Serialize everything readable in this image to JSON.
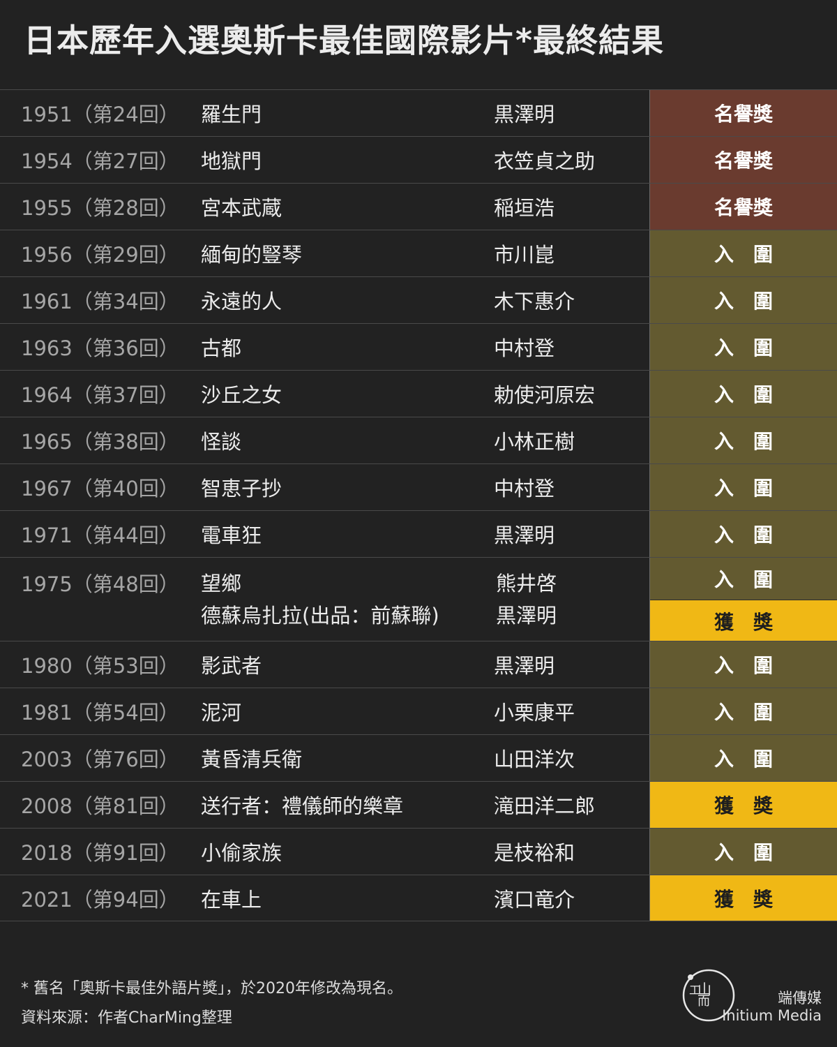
{
  "title": "日本歷年入選奧斯卡最佳國際影片*最終結果",
  "rows": [
    {
      "year": "1951（第24回）",
      "film": "羅生門",
      "director": "黒澤明",
      "result": "名譽獎",
      "type": "honor"
    },
    {
      "year": "1954（第27回）",
      "film": "地獄門",
      "director": "衣笠貞之助",
      "result": "名譽獎",
      "type": "honor"
    },
    {
      "year": "1955（第28回）",
      "film": "宮本武蔵",
      "director": "稲垣浩",
      "result": "名譽獎",
      "type": "honor"
    },
    {
      "year": "1956（第29回）",
      "film": "緬甸的豎琴",
      "director": "市川崑",
      "result": "入　圍",
      "type": "nom"
    },
    {
      "year": "1961（第34回）",
      "film": "永遠的人",
      "director": "木下惠介",
      "result": "入　圍",
      "type": "nom"
    },
    {
      "year": "1963（第36回）",
      "film": "古都",
      "director": "中村登",
      "result": "入　圍",
      "type": "nom"
    },
    {
      "year": "1964（第37回）",
      "film": "沙丘之女",
      "director": "勅使河原宏",
      "result": "入　圍",
      "type": "nom"
    },
    {
      "year": "1965（第38回）",
      "film": "怪談",
      "director": "小林正樹",
      "result": "入　圍",
      "type": "nom"
    },
    {
      "year": "1967（第40回）",
      "film": "智恵子抄",
      "director": "中村登",
      "result": "入　圍",
      "type": "nom"
    },
    {
      "year": "1971（第44回）",
      "film": "電車狂",
      "director": "黒澤明",
      "result": "入　圍",
      "type": "nom"
    },
    {
      "year": "1975（第48回）",
      "film_lines": [
        "望鄉",
        "德蘇烏扎拉(出品：前蘇聯)"
      ],
      "director_lines": [
        "熊井啓",
        "黒澤明"
      ],
      "results": [
        {
          "label": "入　圍",
          "type": "nom"
        },
        {
          "label": "獲　獎",
          "type": "win"
        }
      ]
    },
    {
      "year": "1980（第53回）",
      "film": "影武者",
      "director": "黒澤明",
      "result": "入　圍",
      "type": "nom"
    },
    {
      "year": "1981（第54回）",
      "film": "泥河",
      "director": "小栗康平",
      "result": "入　圍",
      "type": "nom"
    },
    {
      "year": "2003（第76回）",
      "film": "黃昏清兵衛",
      "director": "山田洋次",
      "result": "入　圍",
      "type": "nom"
    },
    {
      "year": "2008（第81回）",
      "film": "送行者：禮儀師的樂章",
      "director": "滝田洋二郎",
      "result": "獲　獎",
      "type": "win"
    },
    {
      "year": "2018（第91回）",
      "film": "小偷家族",
      "director": "是枝裕和",
      "result": "入　圍",
      "type": "nom"
    },
    {
      "year": "2021（第94回）",
      "film": "在車上",
      "director": "濱口竜介",
      "result": "獲　獎",
      "type": "win"
    }
  ],
  "footnote": "* 舊名「奧斯卡最佳外語片獎」，於2020年修改為現名。",
  "source": "資料來源：作者CharMing整理",
  "logo": {
    "chinese": "端傳媒",
    "english": "Initium Media",
    "mark": "端"
  },
  "colors": {
    "honor": "#6a3b2f",
    "nominated": "#635a30",
    "won": "#f0b815",
    "background": "#222222"
  }
}
